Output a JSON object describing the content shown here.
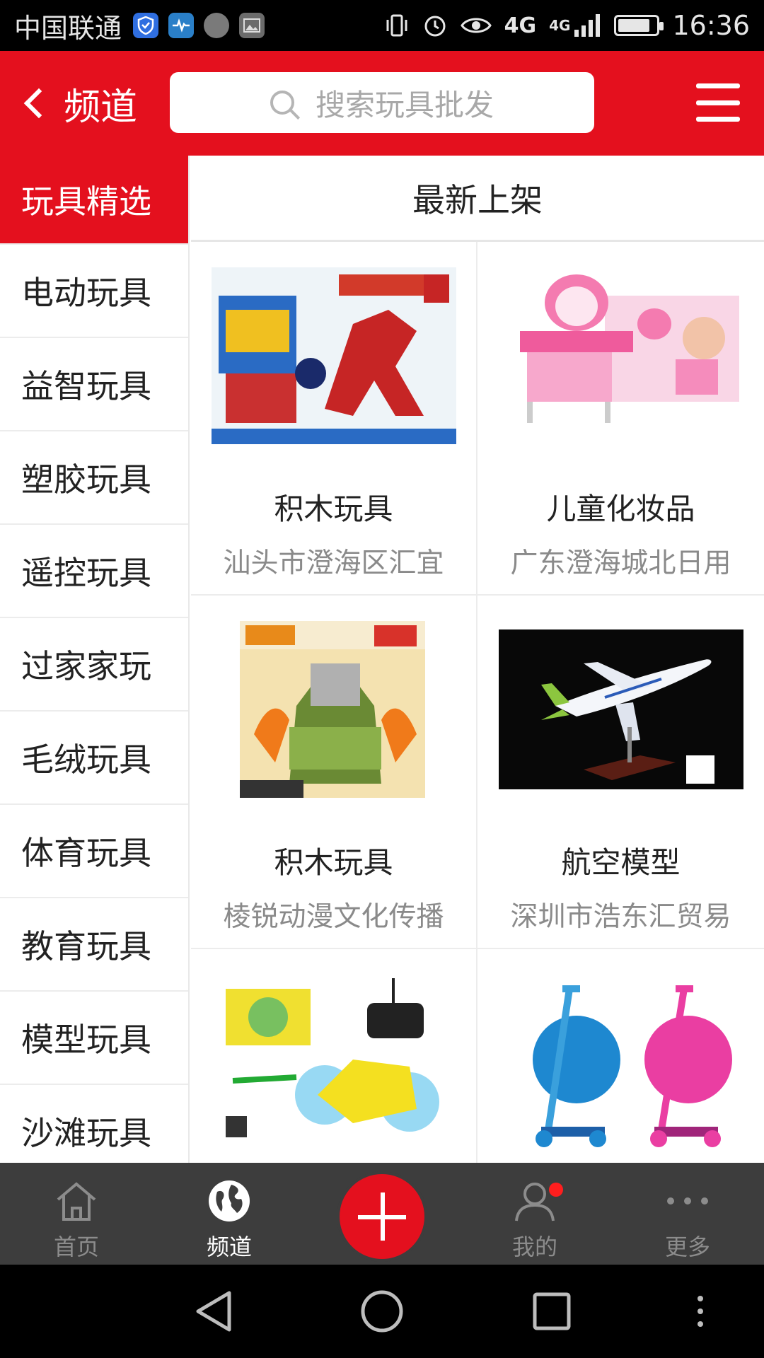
{
  "status_bar": {
    "carrier": "中国联通",
    "network": "4G",
    "signal_network": "4G",
    "time": "16:36",
    "battery_level": 0.85,
    "icons": [
      "shield-icon",
      "health-icon",
      "avatar-icon",
      "gallery-icon",
      "vibrate-icon",
      "alarm-icon",
      "eye-icon",
      "signal-icon",
      "battery-icon"
    ]
  },
  "header": {
    "back_label": "频道",
    "search_placeholder": "搜索玩具批发",
    "menu_icon": "hamburger-icon",
    "brand_color": "#e4101e"
  },
  "sidebar": {
    "items": [
      {
        "label": "玩具精选",
        "active": true
      },
      {
        "label": "电动玩具"
      },
      {
        "label": "益智玩具"
      },
      {
        "label": "塑胶玩具"
      },
      {
        "label": "遥控玩具"
      },
      {
        "label": "过家家玩"
      },
      {
        "label": "毛绒玩具"
      },
      {
        "label": "体育玩具"
      },
      {
        "label": "教育玩具"
      },
      {
        "label": "模型玩具"
      },
      {
        "label": "沙滩玩具"
      }
    ]
  },
  "content": {
    "section_title": "最新上架",
    "products": [
      {
        "title": "积木玩具",
        "seller": "汕头市澄海区汇宜",
        "image": "dinosaur-blocks-box"
      },
      {
        "title": "儿童化妆品",
        "seller": "广东澄海城北日用",
        "image": "vanity-playset"
      },
      {
        "title": "积木玩具",
        "seller": "棱锐动漫文化传播",
        "image": "robot-blocks-box"
      },
      {
        "title": "航空模型",
        "seller": "深圳市浩东汇贸易",
        "image": "airplane-model"
      },
      {
        "title": "",
        "seller": "",
        "image": "rc-stunt-car"
      },
      {
        "title": "",
        "seller": "",
        "image": "kick-scooters"
      }
    ]
  },
  "bottom_nav": {
    "items": [
      {
        "label": "首页",
        "icon": "home-icon"
      },
      {
        "label": "频道",
        "icon": "globe-icon",
        "active": true
      },
      {
        "label": "",
        "icon": "plus-icon"
      },
      {
        "label": "我的",
        "icon": "user-icon",
        "badge": true
      },
      {
        "label": "更多",
        "icon": "more-icon"
      }
    ]
  },
  "system_nav": {
    "icons": [
      "back-triangle-icon",
      "home-circle-icon",
      "recents-square-icon",
      "overflow-dots-icon"
    ]
  }
}
